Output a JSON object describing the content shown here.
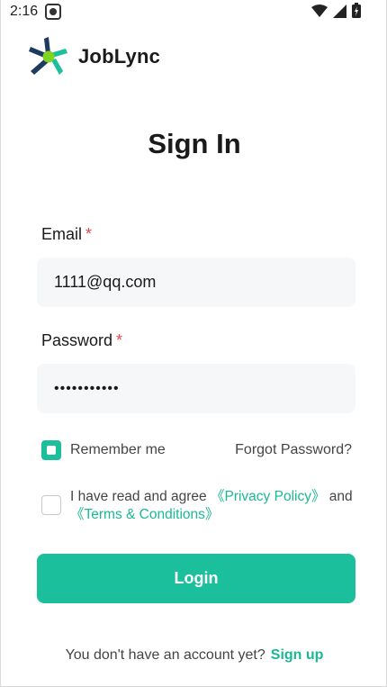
{
  "status_bar": {
    "time": "2:16",
    "icons": [
      "photo-notification-icon",
      "wifi-icon",
      "signal-icon",
      "battery-icon"
    ]
  },
  "brand": {
    "name": "JobLync",
    "logo_icon": "joblync-logo-icon"
  },
  "page": {
    "title": "Sign In"
  },
  "email": {
    "label": "Email",
    "required_mark": "*",
    "value": "1111@qq.com"
  },
  "password": {
    "label": "Password",
    "required_mark": "*",
    "masked_value": "•••••••••••"
  },
  "remember": {
    "label": "Remember me",
    "checked": true
  },
  "forgot": {
    "label": "Forgot Password?"
  },
  "agreement": {
    "prefix": "I have read and agree ",
    "privacy": "《Privacy Policy》",
    "and": " and",
    "terms": "《Terms & Conditions》",
    "checked": false
  },
  "login": {
    "label": "Login"
  },
  "signup": {
    "prompt": "You don't have an account yet?",
    "link": "Sign up"
  },
  "colors": {
    "accent": "#1cbf9b",
    "required": "#e5484d",
    "field_bg": "#f6f7f9"
  }
}
